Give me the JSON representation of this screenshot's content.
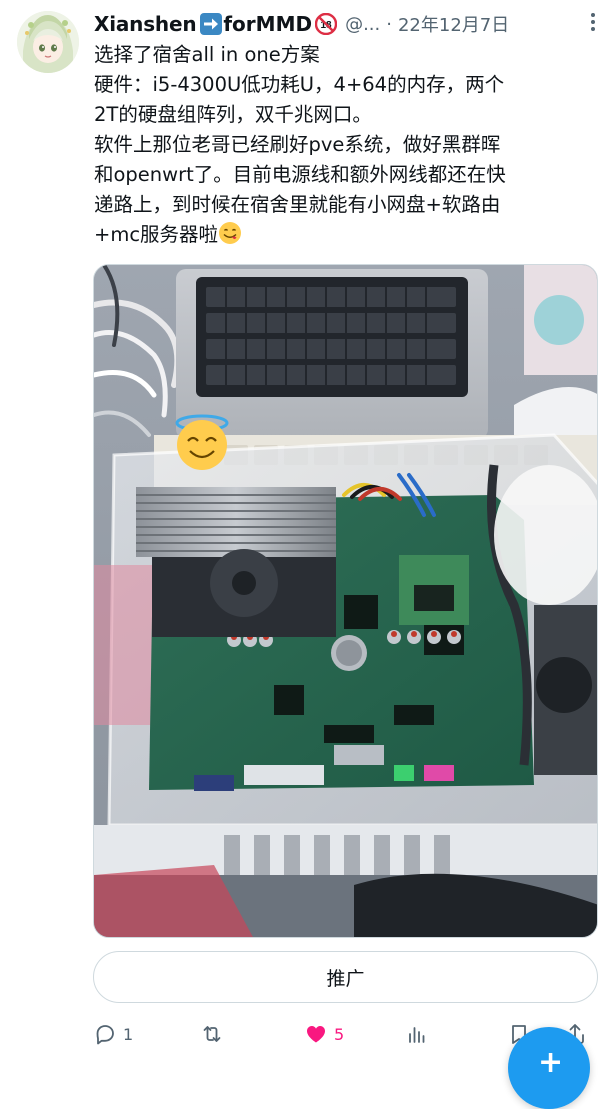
{
  "tweet": {
    "display_name": "Xianshen",
    "display_name_suffix": "forMMD",
    "handle": "@...",
    "separator": "·",
    "date": "22年12月7日",
    "text_lines": [
      "选择了宿舍all in one方案",
      "硬件：i5-4300U低功耗U，4+64的内存，两个",
      "2T的硬盘组阵列，双千兆网口。",
      "软件上那位老哥已经刷好pve系统，做好黑群晖",
      "和openwrt了。目前电源线和额外网线都还在快",
      "递路上，到时候在宿舍里就能有小网盘+软路由",
      "+mc服务器啦"
    ],
    "promote_label": "推广",
    "reply_count": "1",
    "retweet_count": "",
    "like_count": "5",
    "colors": {
      "accent": "#1d9bf0",
      "like": "#f91880",
      "secondary_text": "#536471"
    },
    "icons": {
      "name_arrow": "right-arrow-emoji",
      "badge": "no-under-18-emoji",
      "more": "more-vertical-icon",
      "text_emoji": "face-savoring-food-emoji",
      "image_overlay_emoji": "smiling-face-with-halo-emoji",
      "reply": "reply-icon",
      "retweet": "retweet-icon",
      "like": "heart-icon",
      "views": "views-icon",
      "bookmark": "bookmark-icon",
      "share": "share-icon",
      "compose": "compose-plus-icon"
    }
  }
}
